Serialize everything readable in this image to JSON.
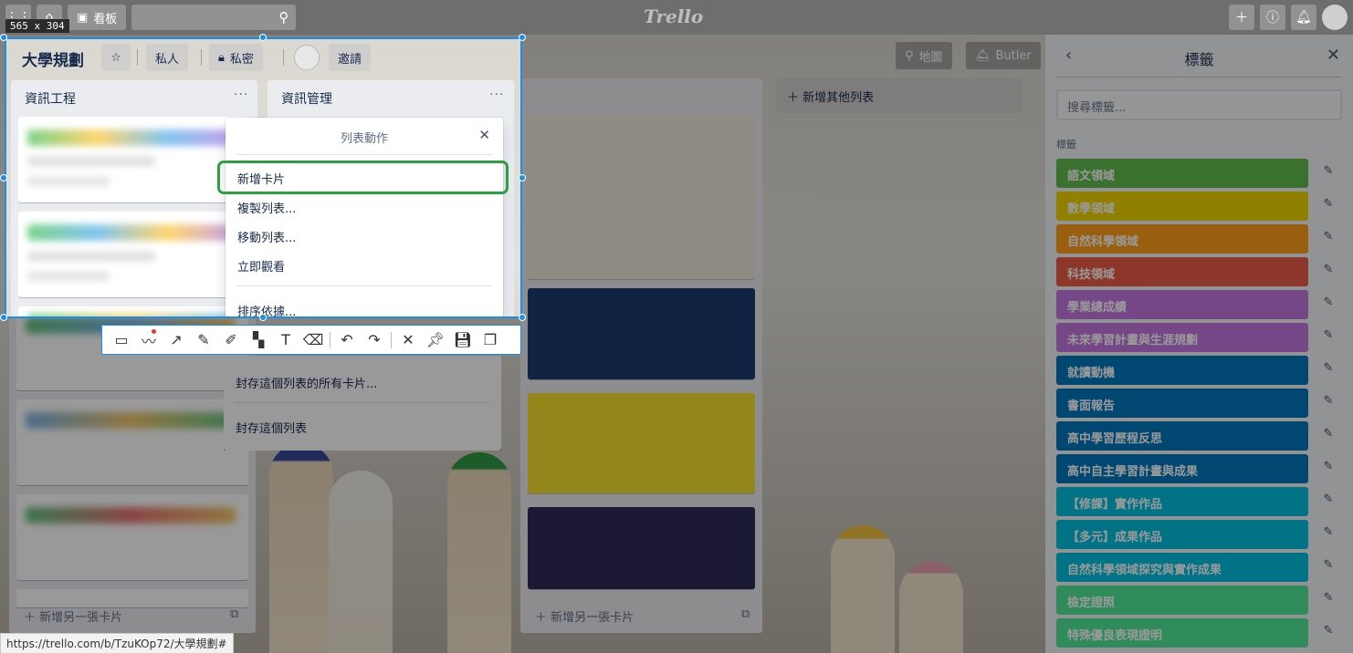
{
  "topbar": {
    "boards_label": "看板",
    "logo": "Trello"
  },
  "header": {
    "title": "大學規劃",
    "visibility_team": "私人",
    "visibility": "私密",
    "invite": "邀請",
    "map": "地圖",
    "butler": "Butler"
  },
  "lists": {
    "list1_title": "資訊工程",
    "list2_title": "資訊管理",
    "menu_glyph": "···",
    "add_card": "新增另一張卡片",
    "add_list": "新增其他列表"
  },
  "popover": {
    "title": "列表動作",
    "items": [
      "新增卡片",
      "複製列表...",
      "移動列表...",
      "立即觀看",
      "排序依據...",
      "封存這個列表的所有卡片...",
      "封存這個列表"
    ]
  },
  "selection": {
    "size_label": "565 x 304"
  },
  "panel": {
    "title": "標籤",
    "search_placeholder": "搜尋標籤...",
    "section_label": "標籤",
    "labels": [
      {
        "name": "語文領域",
        "color": "#61bd4f"
      },
      {
        "name": "數學領域",
        "color": "#f2d600"
      },
      {
        "name": "自然科學領域",
        "color": "#ff9f1a"
      },
      {
        "name": "科技領域",
        "color": "#eb5a46"
      },
      {
        "name": "學業總成績",
        "color": "#c377e0"
      },
      {
        "name": "未來學習計畫與生涯規劃",
        "color": "#c377e0"
      },
      {
        "name": "就讀動機",
        "color": "#0079bf"
      },
      {
        "name": "書面報告",
        "color": "#0079bf"
      },
      {
        "name": "高中學習歷程反思",
        "color": "#0079bf"
      },
      {
        "name": "高中自主學習計畫與成果",
        "color": "#0079bf"
      },
      {
        "name": "【修課】實作作品",
        "color": "#00c2e0"
      },
      {
        "name": "【多元】成果作品",
        "color": "#00c2e0"
      },
      {
        "name": "自然科學領域探究與實作成果",
        "color": "#00c2e0"
      },
      {
        "name": "檢定證照",
        "color": "#51e898"
      },
      {
        "name": "特殊優良表現證明",
        "color": "#51e898"
      }
    ]
  },
  "status_url": "https://trello.com/b/TzuKOp72/大學規劃#"
}
